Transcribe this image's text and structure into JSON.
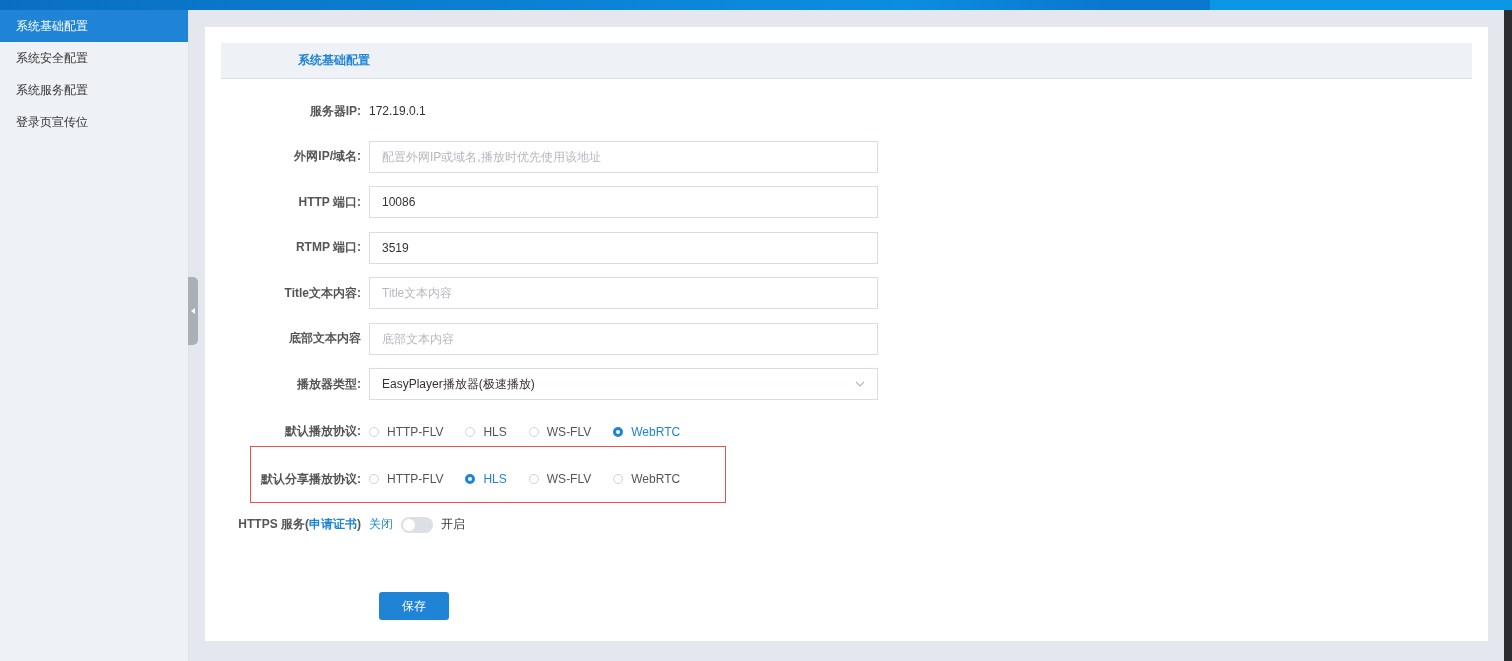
{
  "sidebar": {
    "items": [
      {
        "label": "系统基础配置",
        "selected": true
      },
      {
        "label": "系统安全配置",
        "selected": false
      },
      {
        "label": "系统服务配置",
        "selected": false
      },
      {
        "label": "登录页宣传位",
        "selected": false
      }
    ]
  },
  "card": {
    "title": "系统基础配置"
  },
  "form": {
    "rows": [
      {
        "kind": "text",
        "label": "服务器IP:",
        "value": "172.19.0.1"
      },
      {
        "kind": "input",
        "label": "外网IP/域名:",
        "placeholder": "配置外网IP或域名,播放时优先使用该地址"
      },
      {
        "kind": "input",
        "label": "HTTP 端口:",
        "value": "10086"
      },
      {
        "kind": "input",
        "label": "RTMP 端口:",
        "value": "3519"
      },
      {
        "kind": "input",
        "label": "Title文本内容:",
        "placeholder": "Title文本内容"
      },
      {
        "kind": "input",
        "label": "底部文本内容",
        "placeholder": "底部文本内容"
      },
      {
        "kind": "select",
        "label": "播放器类型:",
        "value": "EasyPlayer播放器(极速播放)"
      },
      {
        "kind": "radio",
        "label": "默认播放协议:",
        "highlighted": false,
        "options": [
          {
            "label": "HTTP-FLV",
            "selected": false
          },
          {
            "label": "HLS",
            "selected": false
          },
          {
            "label": "WS-FLV",
            "selected": false
          },
          {
            "label": "WebRTC",
            "selected": true
          }
        ]
      },
      {
        "kind": "radio",
        "label": "默认分享播放协议:",
        "highlighted": true,
        "options": [
          {
            "label": "HTTP-FLV",
            "selected": false
          },
          {
            "label": "HLS",
            "selected": true
          },
          {
            "label": "WS-FLV",
            "selected": false
          },
          {
            "label": "WebRTC",
            "selected": false
          }
        ]
      },
      {
        "kind": "switch",
        "label": "HTTPS 服务(",
        "link": "申请证书",
        "label_end": ")",
        "off_label": "关闭",
        "on_label": "开启",
        "on": false
      }
    ],
    "save_button": "保存"
  }
}
